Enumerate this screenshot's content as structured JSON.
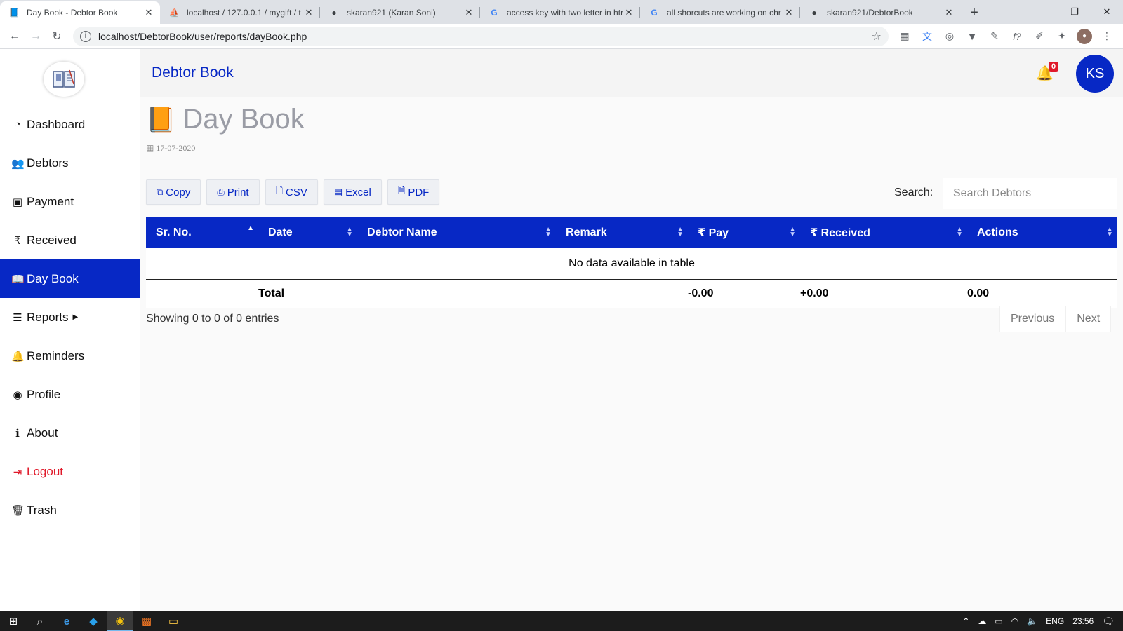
{
  "browser": {
    "tabs": [
      {
        "title": "Day Book - Debtor Book",
        "icon": "book-icon",
        "active": true
      },
      {
        "title": "localhost / 127.0.0.1 / mygift / t",
        "icon": "phpmyadmin-icon",
        "active": false
      },
      {
        "title": "skaran921 (Karan Soni)",
        "icon": "github-icon",
        "active": false
      },
      {
        "title": "access key with two letter in htr",
        "icon": "google-icon",
        "active": false
      },
      {
        "title": "all shorcuts are working on chr",
        "icon": "google-icon",
        "active": false
      },
      {
        "title": "skaran921/DebtorBook",
        "icon": "github-icon",
        "active": false
      }
    ],
    "url": "localhost/DebtorBook/user/reports/dayBook.php"
  },
  "app": {
    "brand": "Debtor Book",
    "notification_count": "0",
    "avatar_initials": "KS",
    "accent_color": "#0728c5",
    "danger_color": "#e0192a"
  },
  "sidebar": {
    "items": [
      {
        "label": "Dashboard",
        "icon": "dashboard-icon"
      },
      {
        "label": "Debtors",
        "icon": "users-icon"
      },
      {
        "label": "Payment",
        "icon": "money-icon"
      },
      {
        "label": "Received",
        "icon": "rupee-icon"
      },
      {
        "label": "Day Book",
        "icon": "book-icon",
        "active": true
      },
      {
        "label": "Reports",
        "icon": "list-icon"
      },
      {
        "label": "Reminders",
        "icon": "bell-icon"
      },
      {
        "label": "Profile",
        "icon": "user-circle-icon"
      },
      {
        "label": "About",
        "icon": "info-icon"
      },
      {
        "label": "Logout",
        "icon": "sign-out-icon"
      },
      {
        "label": "Trash",
        "icon": "trash-icon"
      }
    ]
  },
  "page": {
    "title": "Day Book",
    "date": "17-07-2020"
  },
  "export_buttons": [
    "Copy",
    "Print",
    "CSV",
    "Excel",
    "PDF"
  ],
  "search": {
    "label": "Search:",
    "placeholder": "Search Debtors"
  },
  "table": {
    "columns": [
      "Sr. No.",
      "Date",
      "Debtor Name",
      "Remark",
      "Pay",
      "Received",
      "Actions"
    ],
    "empty_message": "No data available in table",
    "totals": {
      "label": "Total",
      "pay": "-0.00",
      "received": "+0.00",
      "actions": "0.00"
    }
  },
  "footer": {
    "info": "Showing 0 to 0 of 0 entries",
    "previous": "Previous",
    "next": "Next"
  },
  "taskbar": {
    "language": "ENG",
    "time": "23:56"
  }
}
